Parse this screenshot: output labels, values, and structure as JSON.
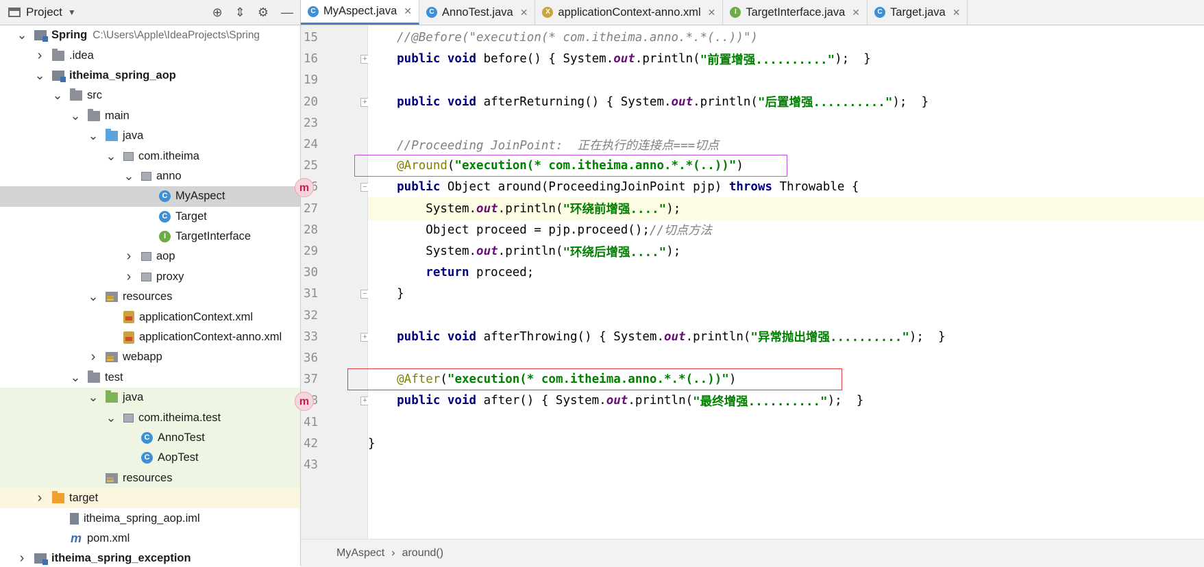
{
  "panel": {
    "title": "Project",
    "tree": [
      {
        "label": "Spring",
        "hint": "C:\\Users\\Apple\\IdeaProjects\\Spring",
        "indent": 0,
        "arrow": "down",
        "icon": "module",
        "bold": true
      },
      {
        "label": ".idea",
        "indent": 1,
        "arrow": "right",
        "icon": "folder"
      },
      {
        "label": "itheima_spring_aop",
        "indent": 1,
        "arrow": "down",
        "icon": "module",
        "bold": true
      },
      {
        "label": "src",
        "indent": 2,
        "arrow": "down",
        "icon": "folder"
      },
      {
        "label": "main",
        "indent": 3,
        "arrow": "down",
        "icon": "folder"
      },
      {
        "label": "java",
        "indent": 4,
        "arrow": "down",
        "icon": "blue"
      },
      {
        "label": "com.itheima",
        "indent": 5,
        "arrow": "down",
        "icon": "package"
      },
      {
        "label": "anno",
        "indent": 6,
        "arrow": "down",
        "icon": "package"
      },
      {
        "label": "MyAspect",
        "indent": 7,
        "arrow": "none",
        "icon": "class",
        "selected": true
      },
      {
        "label": "Target",
        "indent": 7,
        "arrow": "none",
        "icon": "class"
      },
      {
        "label": "TargetInterface",
        "indent": 7,
        "arrow": "none",
        "icon": "interface"
      },
      {
        "label": "aop",
        "indent": 6,
        "arrow": "right",
        "icon": "package"
      },
      {
        "label": "proxy",
        "indent": 6,
        "arrow": "right",
        "icon": "package"
      },
      {
        "label": "resources",
        "indent": 4,
        "arrow": "down",
        "icon": "res"
      },
      {
        "label": "applicationContext.xml",
        "indent": 5,
        "arrow": "none",
        "icon": "xml"
      },
      {
        "label": "applicationContext-anno.xml",
        "indent": 5,
        "arrow": "none",
        "icon": "xml"
      },
      {
        "label": "webapp",
        "indent": 4,
        "arrow": "right",
        "icon": "res"
      },
      {
        "label": "test",
        "indent": 3,
        "arrow": "down",
        "icon": "folder"
      },
      {
        "label": "java",
        "indent": 4,
        "arrow": "down",
        "icon": "green",
        "test": true
      },
      {
        "label": "com.itheima.test",
        "indent": 5,
        "arrow": "down",
        "icon": "package",
        "test": true
      },
      {
        "label": "AnnoTest",
        "indent": 6,
        "arrow": "none",
        "icon": "testclass",
        "test": true
      },
      {
        "label": "AopTest",
        "indent": 6,
        "arrow": "none",
        "icon": "testclass",
        "test": true
      },
      {
        "label": "resources",
        "indent": 4,
        "arrow": "none",
        "icon": "res",
        "test": true
      },
      {
        "label": "target",
        "indent": 1,
        "arrow": "right",
        "icon": "orange",
        "excluded": true
      },
      {
        "label": "itheima_spring_aop.iml",
        "indent": 2,
        "arrow": "none",
        "icon": "iml"
      },
      {
        "label": "pom.xml",
        "indent": 2,
        "arrow": "none",
        "icon": "maven"
      },
      {
        "label": "itheima_spring_exception",
        "indent": 0,
        "arrow": "right",
        "icon": "module",
        "bold": true
      }
    ]
  },
  "tabs": [
    {
      "label": "MyAspect.java",
      "icon": "C",
      "color": "#3d90d6",
      "active": true,
      "close": true
    },
    {
      "label": "AnnoTest.java",
      "icon": "C",
      "color": "#3d90d6",
      "close": true
    },
    {
      "label": "applicationContext-anno.xml",
      "icon": "X",
      "color": "#c9a33d",
      "close": true
    },
    {
      "label": "TargetInterface.java",
      "icon": "I",
      "color": "#6cab4a",
      "close": true
    },
    {
      "label": "Target.java",
      "icon": "C",
      "color": "#3d90d6",
      "close": true
    }
  ],
  "code": [
    {
      "n": "15",
      "fold": "",
      "parts": [
        [
          "cmt",
          "    //@Before(\"execution(* com.itheima.anno.*.*(..))\")"
        ]
      ]
    },
    {
      "n": "16",
      "fold": "+",
      "parts": [
        [
          "kw",
          "    public void "
        ],
        [
          "",
          "before() { System."
        ],
        [
          "fld",
          "out"
        ],
        [
          "",
          ".println("
        ],
        [
          "str",
          "\"前置增强..........\""
        ],
        [
          "",
          ");  }"
        ]
      ]
    },
    {
      "n": "19",
      "fold": "",
      "parts": []
    },
    {
      "n": "20",
      "fold": "+",
      "parts": [
        [
          "kw",
          "    public void "
        ],
        [
          "",
          "afterReturning() { System."
        ],
        [
          "fld",
          "out"
        ],
        [
          "",
          ".println("
        ],
        [
          "str",
          "\"后置增强..........\""
        ],
        [
          "",
          ");  }"
        ]
      ]
    },
    {
      "n": "23",
      "fold": "",
      "parts": []
    },
    {
      "n": "24",
      "fold": "",
      "parts": [
        [
          "cmt",
          "    //Proceeding JoinPoint:  正在执行的连接点===切点"
        ]
      ]
    },
    {
      "n": "25",
      "fold": "",
      "parts": [
        [
          "anno",
          "    @Around"
        ],
        [
          "",
          "("
        ],
        [
          "str",
          "\"execution(* com.itheima.anno.*.*(..))\""
        ],
        [
          "",
          ")"
        ]
      ]
    },
    {
      "n": "26",
      "fold": "-",
      "marker": "m",
      "parts": [
        [
          "kw",
          "    public "
        ],
        [
          "",
          "Object around(ProceedingJoinPoint pjp) "
        ],
        [
          "kw",
          "throws "
        ],
        [
          "",
          "Throwable {"
        ]
      ]
    },
    {
      "n": "27",
      "fold": "",
      "current": true,
      "parts": [
        [
          "",
          "        System."
        ],
        [
          "fld",
          "out"
        ],
        [
          "",
          ".println("
        ],
        [
          "str",
          "\"环绕前增强....\""
        ],
        [
          "",
          ");"
        ]
      ]
    },
    {
      "n": "28",
      "fold": "",
      "parts": [
        [
          "",
          "        Object proceed = pjp.proceed();"
        ],
        [
          "cmt",
          "//切点方法"
        ]
      ]
    },
    {
      "n": "29",
      "fold": "",
      "parts": [
        [
          "",
          "        System."
        ],
        [
          "fld",
          "out"
        ],
        [
          "",
          ".println("
        ],
        [
          "str",
          "\"环绕后增强....\""
        ],
        [
          "",
          ");"
        ]
      ]
    },
    {
      "n": "30",
      "fold": "",
      "parts": [
        [
          "kw",
          "        return "
        ],
        [
          "",
          "proceed;"
        ]
      ]
    },
    {
      "n": "31",
      "fold": "-",
      "parts": [
        [
          "",
          "    }"
        ]
      ]
    },
    {
      "n": "32",
      "fold": "",
      "parts": []
    },
    {
      "n": "33",
      "fold": "+",
      "parts": [
        [
          "kw",
          "    public void "
        ],
        [
          "",
          "afterThrowing() { System."
        ],
        [
          "fld",
          "out"
        ],
        [
          "",
          ".println("
        ],
        [
          "str",
          "\"异常抛出增强..........\""
        ],
        [
          "",
          ");  }"
        ]
      ]
    },
    {
      "n": "36",
      "fold": "",
      "parts": []
    },
    {
      "n": "37",
      "fold": "",
      "parts": [
        [
          "anno",
          "    @After"
        ],
        [
          "",
          "("
        ],
        [
          "str",
          "\"execution(* com.itheima.anno.*.*(..))\""
        ],
        [
          "",
          ")"
        ]
      ]
    },
    {
      "n": "38",
      "fold": "+",
      "marker": "m",
      "parts": [
        [
          "kw",
          "    public void "
        ],
        [
          "",
          "after() { System."
        ],
        [
          "fld",
          "out"
        ],
        [
          "",
          ".println("
        ],
        [
          "str",
          "\"最终增强..........\""
        ],
        [
          "",
          ");  }"
        ]
      ]
    },
    {
      "n": "41",
      "fold": "",
      "parts": []
    },
    {
      "n": "42",
      "fold": "",
      "parts": [
        [
          "",
          "}"
        ]
      ]
    },
    {
      "n": "43",
      "fold": "",
      "parts": []
    }
  ],
  "breadcrumb": [
    "MyAspect",
    "around()"
  ],
  "breadcrumb_sep": "›",
  "colors": {
    "accent": "#4083c9",
    "around_box": "#c24fd8",
    "after_box": "#e23b3b"
  }
}
